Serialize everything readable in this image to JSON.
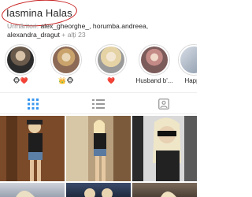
{
  "profile": {
    "name": "Iasmina Halas",
    "followers_prefix": "Urmăritori:",
    "followers_names": "alex_gheorghe_, horumba.andreea, alexandra_dragut",
    "followers_more": "+ alți 23"
  },
  "highlights": [
    {
      "label": "🐵❤️"
    },
    {
      "label": "👑🐵"
    },
    {
      "label": "❤️"
    },
    {
      "label": "Husband b'..."
    },
    {
      "label": "Happy"
    }
  ],
  "tabs": [
    {
      "icon": "grid-icon",
      "active": true
    },
    {
      "icon": "list-icon",
      "active": false
    },
    {
      "icon": "tagged-icon",
      "active": false
    }
  ],
  "colors": {
    "accent": "#3897f0",
    "annotation": "#c81e1e"
  }
}
